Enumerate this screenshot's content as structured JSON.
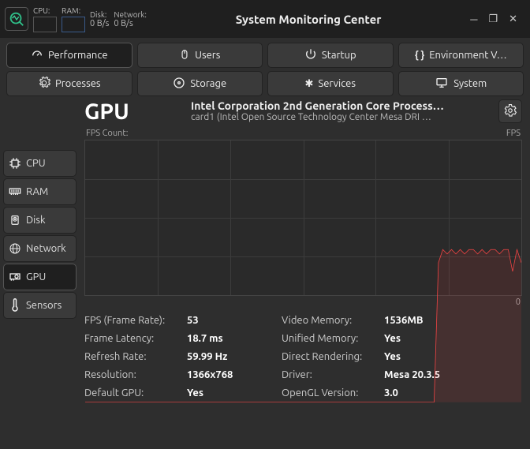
{
  "topbar": {
    "cpu_label": "CPU:",
    "ram_label": "RAM:",
    "disk_label": "Disk:",
    "disk_val": "0 B/s",
    "net_label": "Network:",
    "net_val": "0 B/s",
    "title": "System Monitoring Center"
  },
  "tabs_top": [
    {
      "label": "Performance",
      "active": true
    },
    {
      "label": "Users",
      "active": false
    },
    {
      "label": "Startup",
      "active": false
    },
    {
      "label": "Environment V…",
      "active": false
    }
  ],
  "tabs_bottom": [
    {
      "label": "Processes"
    },
    {
      "label": "Storage"
    },
    {
      "label": "Services"
    },
    {
      "label": "System"
    }
  ],
  "sidenav": [
    {
      "label": "CPU",
      "active": false
    },
    {
      "label": "RAM",
      "active": false
    },
    {
      "label": "Disk",
      "active": false
    },
    {
      "label": "Network",
      "active": false
    },
    {
      "label": "GPU",
      "active": true
    },
    {
      "label": "Sensors",
      "active": false
    }
  ],
  "header": {
    "title": "GPU",
    "line1": "Intel Corporation 2nd Generation Core Process…",
    "line2": "card1 (Intel Open Source Technology Center Mesa DRI …"
  },
  "chart": {
    "label_left": "FPS Count:",
    "label_right": "FPS",
    "label_bottom": "0"
  },
  "chart_data": {
    "type": "line",
    "title": "FPS Count",
    "xlabel": "",
    "ylabel": "FPS",
    "ylim": [
      0,
      60
    ],
    "x": [
      0,
      5,
      10,
      15,
      20,
      25,
      30,
      35,
      40,
      45,
      50,
      55,
      60,
      65,
      70,
      75,
      80,
      81,
      82,
      83,
      84,
      85,
      86,
      87,
      88,
      89,
      90,
      91,
      92,
      93,
      94,
      95,
      96,
      97,
      98,
      99,
      100
    ],
    "values": [
      0,
      0,
      0,
      0,
      0,
      0,
      0,
      0,
      0,
      0,
      0,
      0,
      0,
      0,
      0,
      0,
      0,
      32,
      35,
      34,
      35,
      34,
      35,
      34,
      35,
      35,
      34,
      35,
      34,
      35,
      35,
      34,
      35,
      35,
      30,
      35,
      32
    ]
  },
  "stats": {
    "fps_label": "FPS (Frame Rate):",
    "fps_val": "53",
    "latency_label": "Frame Latency:",
    "latency_val": "18.7 ms",
    "refresh_label": "Refresh Rate:",
    "refresh_val": "59.99 Hz",
    "res_label": "Resolution:",
    "res_val": "1366x768",
    "default_label": "Default GPU:",
    "default_val": "Yes",
    "vmem_label": "Video Memory:",
    "vmem_val": "1536MB",
    "unified_label": "Unified Memory:",
    "unified_val": "Yes",
    "direct_label": "Direct Rendering:",
    "direct_val": "Yes",
    "driver_label": "Driver:",
    "driver_val": "Mesa 20.3.5",
    "opengl_label": "OpenGL Version:",
    "opengl_val": "3.0"
  }
}
